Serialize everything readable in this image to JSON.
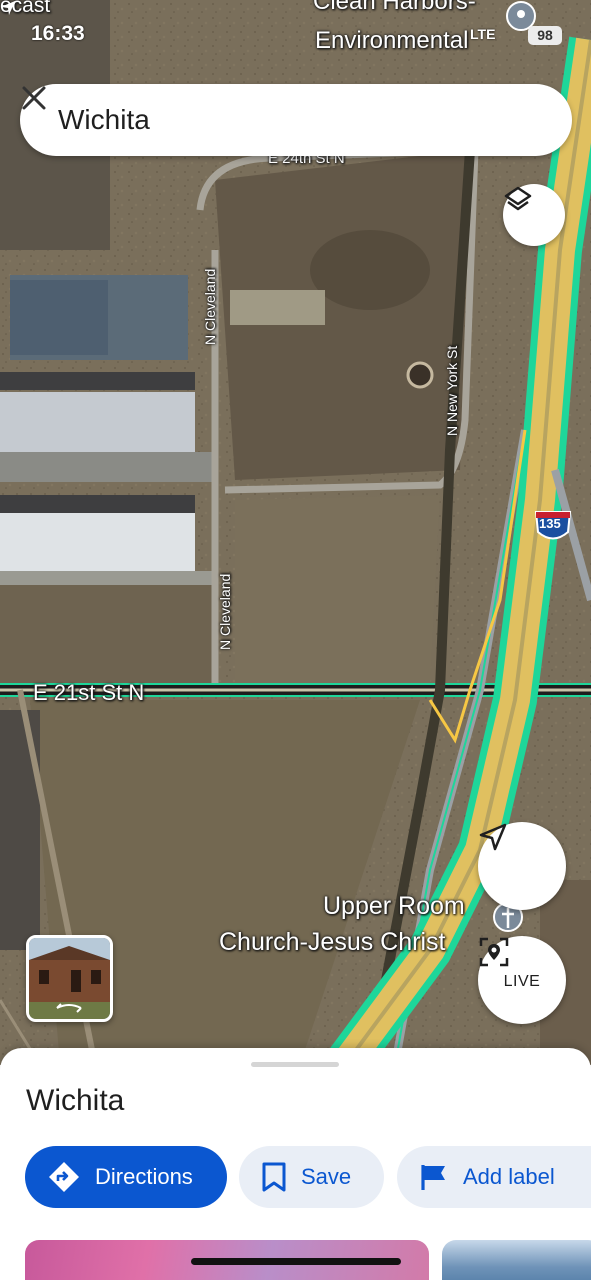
{
  "status_bar": {
    "time": "16:33",
    "network": "LTE",
    "battery": "98",
    "top_left_fragment": "ecast"
  },
  "search": {
    "query": "Wichita",
    "clear_icon": "close-icon"
  },
  "map": {
    "type": "satellite",
    "labels": {
      "poi_top": "Clean Harbors-",
      "poi_top_2": "Environmental",
      "street_24th": "E 24th St N",
      "street_cleveland": "N Cleveland",
      "street_new_york": "N New York St",
      "street_21st": "E 21st St N",
      "highway_shield": "135",
      "church_line1": "Upper Room",
      "church_line2": "Church-Jesus Christ"
    },
    "colors": {
      "highway_green": "#1ed69a",
      "highway_yellow": "#e0c060",
      "ramp_yellow": "#f6c744"
    }
  },
  "buttons": {
    "layers_icon": "layers-icon",
    "locate_icon": "navigation-arrow-icon",
    "live_label": "LIVE",
    "live_icon": "live-view-icon"
  },
  "sheet": {
    "title": "Wichita",
    "actions": {
      "directions": "Directions",
      "save": "Save",
      "add_label": "Add label"
    },
    "accent": "#0b57d0"
  }
}
